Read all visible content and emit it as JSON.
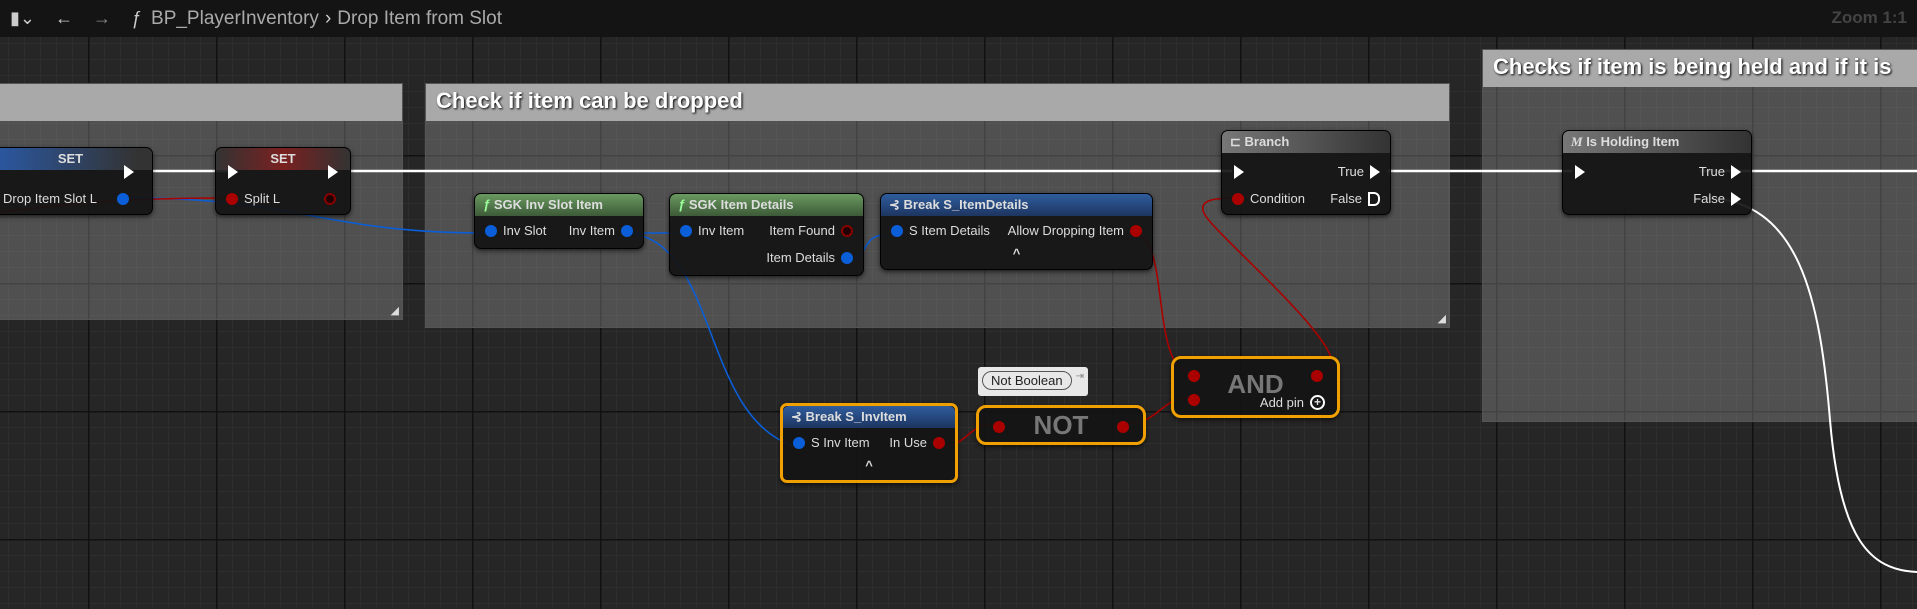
{
  "topbar": {
    "back": "←",
    "forward": "→",
    "func_icon": "ƒ",
    "blueprint": "BP_PlayerInventory",
    "separator": "›",
    "function": "Drop Item from Slot",
    "zoom": "Zoom 1:1"
  },
  "comments": [
    {
      "title": ""
    },
    {
      "title": "Check if item can be dropped"
    },
    {
      "title": "Checks if item is being held and if it is"
    }
  ],
  "nodes": {
    "set_blue": {
      "title": "SET",
      "pin": "Drop Item Slot L"
    },
    "set_red": {
      "title": "SET",
      "pin": "Split L"
    },
    "sgk_inv_slot": {
      "icon": "ƒ",
      "title": "SGK Inv Slot Item",
      "in": "Inv Slot",
      "out": "Inv Item"
    },
    "sgk_item_details": {
      "icon": "ƒ",
      "title": "SGK Item Details",
      "in": "Inv Item",
      "out1": "Item Found",
      "out2": "Item Details"
    },
    "break_item_details": {
      "title": "Break S_ItemDetails",
      "in": "S Item Details",
      "out": "Allow Dropping Item",
      "expand": "^"
    },
    "branch": {
      "title": "Branch",
      "in": "Condition",
      "out_true": "True",
      "out_false": "False"
    },
    "is_holding": {
      "icon": "M",
      "title": "Is Holding Item",
      "out_true": "True",
      "out_false": "False"
    },
    "break_inv_item": {
      "title": "Break S_InvItem",
      "in": "S Inv Item",
      "out": "In Use",
      "expand": "^"
    },
    "not": {
      "title": "NOT",
      "tooltip": "Not Boolean"
    },
    "and": {
      "title": "AND",
      "add_pin": "Add pin"
    }
  },
  "colors": {
    "exec": "#ffffff",
    "struct": "#0a5ed8",
    "bool": "#a00000",
    "select": "#f0a000"
  }
}
